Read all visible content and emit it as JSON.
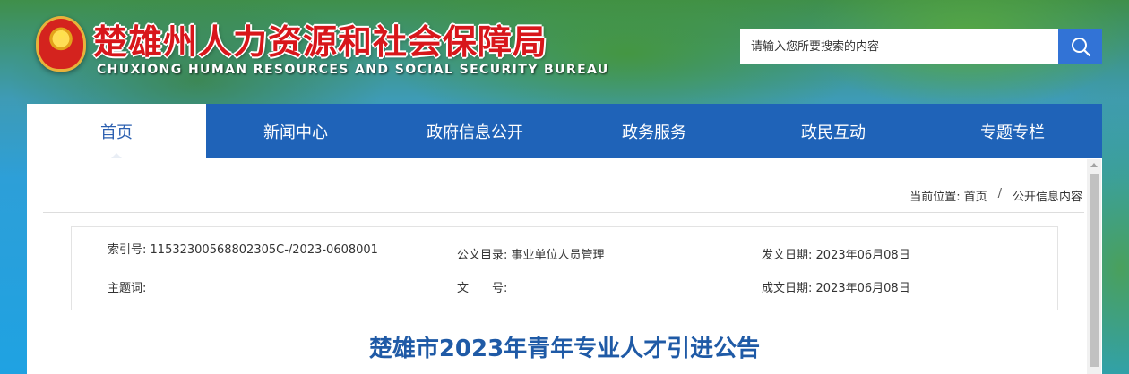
{
  "header": {
    "title": "楚雄州人力资源和社会保障局",
    "subtitle": "CHUXIONG HUMAN RESOURCES AND SOCIAL SECURITY BUREAU",
    "emblem_icon": "national-emblem-icon"
  },
  "search": {
    "placeholder": "请输入您所要搜索的内容",
    "button_icon": "search-icon"
  },
  "nav": {
    "items": [
      {
        "label": "首页",
        "active": true
      },
      {
        "label": "新闻中心"
      },
      {
        "label": "政府信息公开"
      },
      {
        "label": "政务服务"
      },
      {
        "label": "政民互动"
      },
      {
        "label": "专题专栏"
      }
    ]
  },
  "breadcrumb": {
    "prefix": "当前位置:",
    "home": "首页",
    "separator": "/",
    "current": "公开信息内容"
  },
  "info": {
    "index_label": "索引号:",
    "index_value": "11532300568802305C-/2023-0608001",
    "catalog_label": "公文目录:",
    "catalog_value": "事业单位人员管理",
    "issue_date_label": "发文日期:",
    "issue_date_value": "2023年06月08日",
    "keywords_label": "主题词:",
    "keywords_value": "",
    "doc_no_label": "文　　号:",
    "doc_no_value": "",
    "written_date_label": "成文日期:",
    "written_date_value": "2023年06月08日"
  },
  "article": {
    "title": "楚雄市2023年青年专业人才引进公告"
  },
  "colors": {
    "nav_bg": "#1f63b8",
    "title_red": "#d8161b",
    "article_title": "#1f5aa6",
    "search_button": "#3273d6"
  }
}
